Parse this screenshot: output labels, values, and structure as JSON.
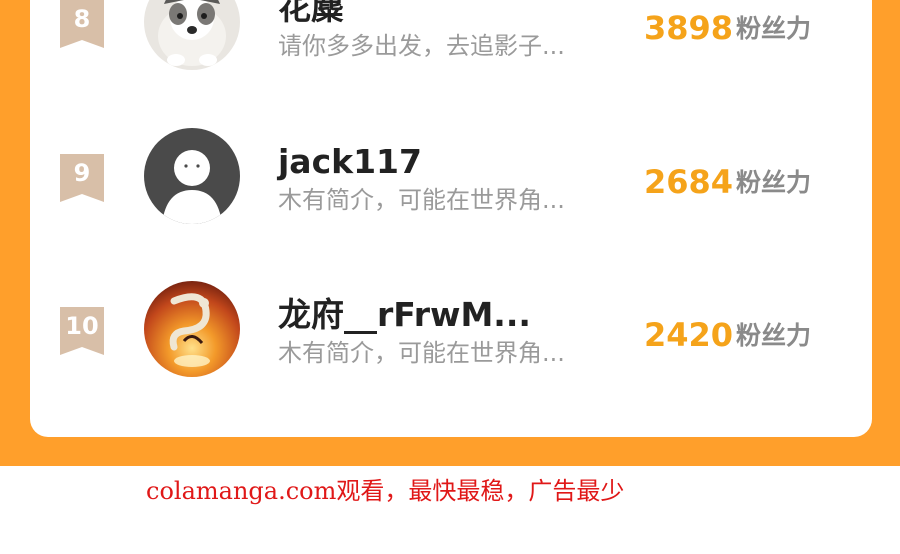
{
  "colors": {
    "background_orange": "#FF9F2B",
    "card_white": "#FFFFFF",
    "fans_value": "#F5A31A",
    "rank_badge": "#D8BFA8",
    "watermark_red": "#E01818"
  },
  "ranking": {
    "fans_unit": "粉丝力",
    "entries": [
      {
        "rank": "8",
        "name": "花麋",
        "bio": "请你多多出发，去追影子...",
        "fans": "3898",
        "avatar_icon": "dog-avatar-icon"
      },
      {
        "rank": "9",
        "name": "jack117",
        "bio": "木有简介，可能在世界角...",
        "fans": "2684",
        "avatar_icon": "default-user-avatar-icon"
      },
      {
        "rank": "10",
        "name": "龙府__rFrwM...",
        "bio": "木有简介，可能在世界角...",
        "fans": "2420",
        "avatar_icon": "dragon-art-avatar-icon"
      }
    ]
  },
  "watermark": "colamanga.com观看，最快最稳，广告最少"
}
